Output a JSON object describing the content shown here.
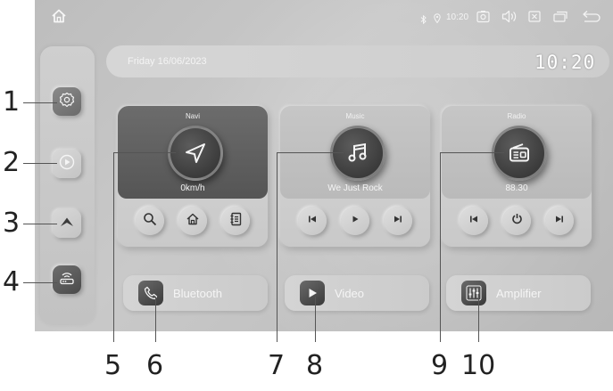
{
  "status_bar": {
    "time": "10:20"
  },
  "header": {
    "date": "Friday 16/06/2023",
    "clock": "10:20"
  },
  "cards": {
    "navi": {
      "title": "Navi",
      "subtitle": "0km/h"
    },
    "music": {
      "title": "Music",
      "subtitle": "We Just Rock"
    },
    "radio": {
      "title": "Radio",
      "subtitle": "88.30"
    }
  },
  "shortcuts": {
    "bluetooth": "Bluetooth",
    "video": "Video",
    "amplifier": "Amplifier"
  },
  "callouts": [
    "1",
    "2",
    "3",
    "4",
    "5",
    "6",
    "7",
    "8",
    "9",
    "10"
  ],
  "icons": {
    "topbar": [
      "home-icon",
      "bluetooth-icon",
      "location-icon",
      "screenshot-icon",
      "volume-icon",
      "close-box-icon",
      "window-icon",
      "back-icon"
    ],
    "sidebar": [
      "settings-icon",
      "play-circle-icon",
      "chevron-up-icon",
      "router-icon"
    ]
  },
  "colors": {
    "accent": "#3a3a3a",
    "text_light": "#f4f4f4",
    "screen_bg": "#c4c4c4"
  }
}
